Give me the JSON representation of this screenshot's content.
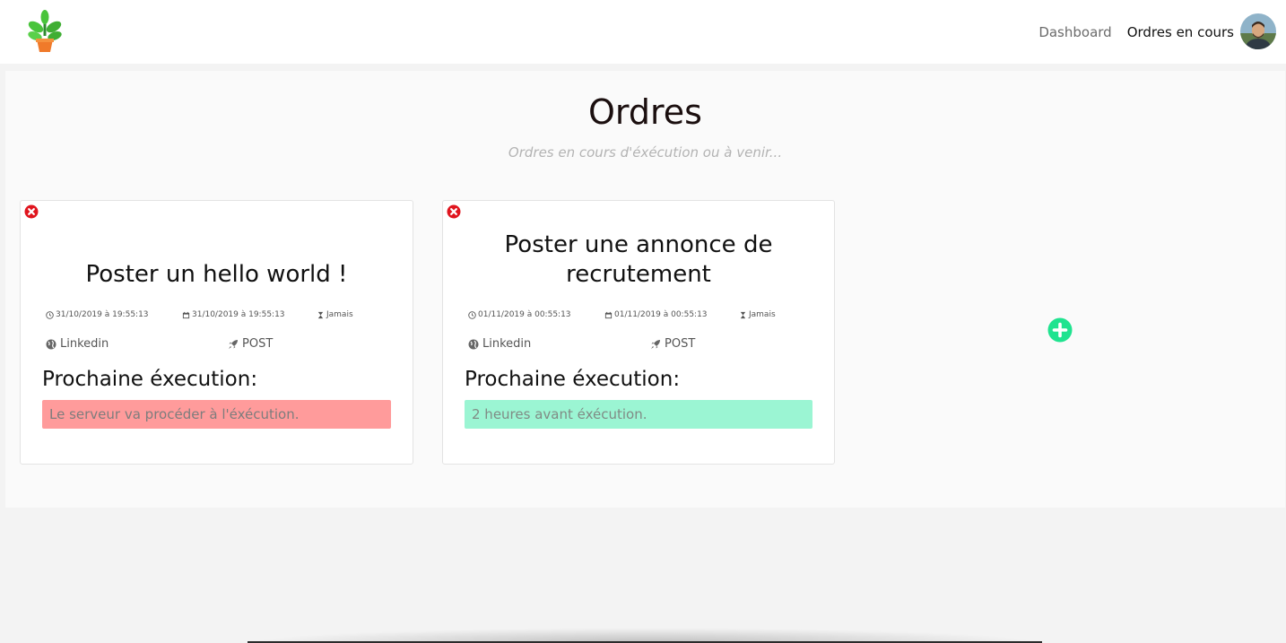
{
  "nav": {
    "links": [
      "Dashboard",
      "Ordres en cours"
    ],
    "active_index": 1
  },
  "page": {
    "title": "Ordres",
    "subtitle": "Ordres en cours d'éxécution ou à venir..."
  },
  "orders": [
    {
      "title": "Poster un hello world !",
      "created": "31/10/2019 à 19:55:13",
      "scheduled": "31/10/2019 à 19:55:13",
      "repeat": "Jamais",
      "network": "Linkedin",
      "method": "POST",
      "next_label": "Prochaine éxecution:",
      "status": "Le serveur va procéder à l'éxécution.",
      "status_type": "danger"
    },
    {
      "title": "Poster une annonce de recrutement",
      "created": "01/11/2019 à 00:55:13",
      "scheduled": "01/11/2019 à 00:55:13",
      "repeat": "Jamais",
      "network": "Linkedin",
      "method": "POST",
      "next_label": "Prochaine éxecution:",
      "status": "2 heures avant éxécution.",
      "status_type": "success"
    }
  ],
  "colors": {
    "danger": "#ff9b9b",
    "success": "#9bf5d3",
    "close": "#e0151e",
    "add": "#1fe38f"
  },
  "icons": {
    "logo": "plant-pot-logo",
    "close": "close-circle-icon",
    "add": "plus-circle-icon",
    "created": "clock-icon",
    "scheduled": "calendar-icon",
    "repeat": "hourglass-icon",
    "network": "globe-icon",
    "method": "rocket-icon"
  }
}
